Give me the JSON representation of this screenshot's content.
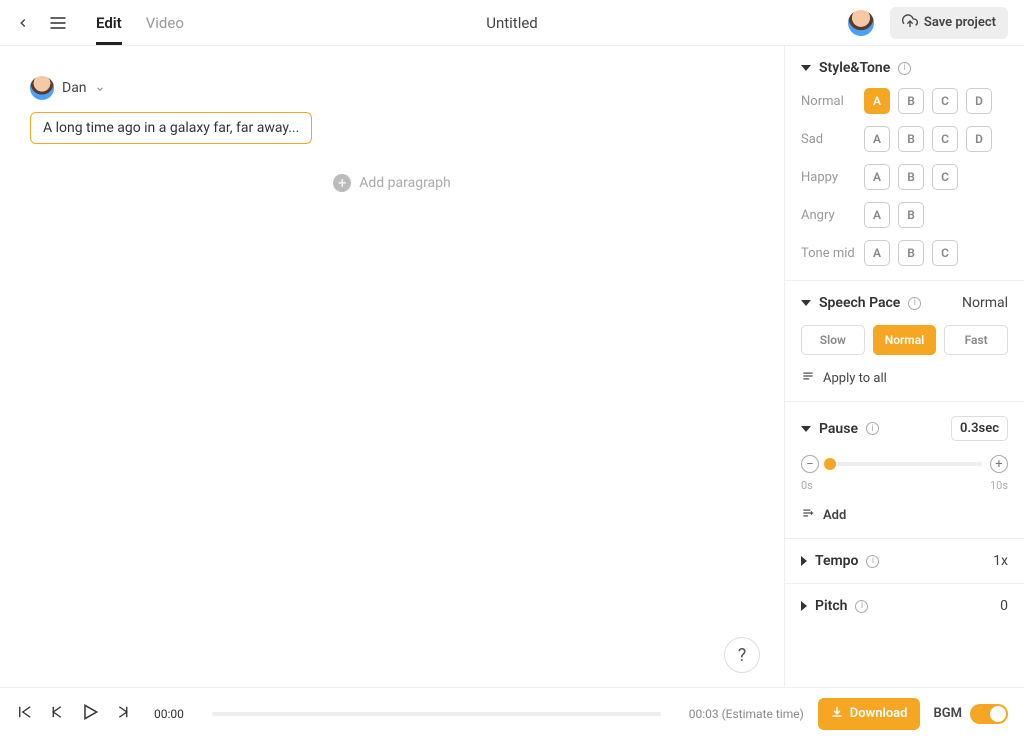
{
  "header": {
    "tabs": {
      "edit": "Edit",
      "video": "Video"
    },
    "title": "Untitled",
    "save_label": "Save project"
  },
  "editor": {
    "speaker": "Dan",
    "speech_text": "A long time ago in a galaxy far, far away...",
    "add_paragraph": "Add paragraph",
    "help": "?"
  },
  "sidebar": {
    "style_tone": {
      "title": "Style&Tone",
      "rows": [
        {
          "label": "Normal",
          "opts": [
            "A",
            "B",
            "C",
            "D"
          ],
          "active": "A"
        },
        {
          "label": "Sad",
          "opts": [
            "A",
            "B",
            "C",
            "D"
          ]
        },
        {
          "label": "Happy",
          "opts": [
            "A",
            "B",
            "C"
          ]
        },
        {
          "label": "Angry",
          "opts": [
            "A",
            "B"
          ]
        },
        {
          "label": "Tone mid",
          "opts": [
            "A",
            "B",
            "C"
          ]
        }
      ]
    },
    "speech_pace": {
      "title": "Speech Pace",
      "value": "Normal",
      "opts": {
        "slow": "Slow",
        "normal": "Normal",
        "fast": "Fast"
      },
      "apply_all": "Apply to all"
    },
    "pause": {
      "title": "Pause",
      "value": "0.3sec",
      "min_label": "0s",
      "max_label": "10s",
      "add": "Add"
    },
    "tempo": {
      "title": "Tempo",
      "value": "1x"
    },
    "pitch": {
      "title": "Pitch",
      "value": "0"
    }
  },
  "transport": {
    "time_start": "00:00",
    "time_end": "00:03 (Estimate time)",
    "download": "Download",
    "bgm": "BGM"
  }
}
